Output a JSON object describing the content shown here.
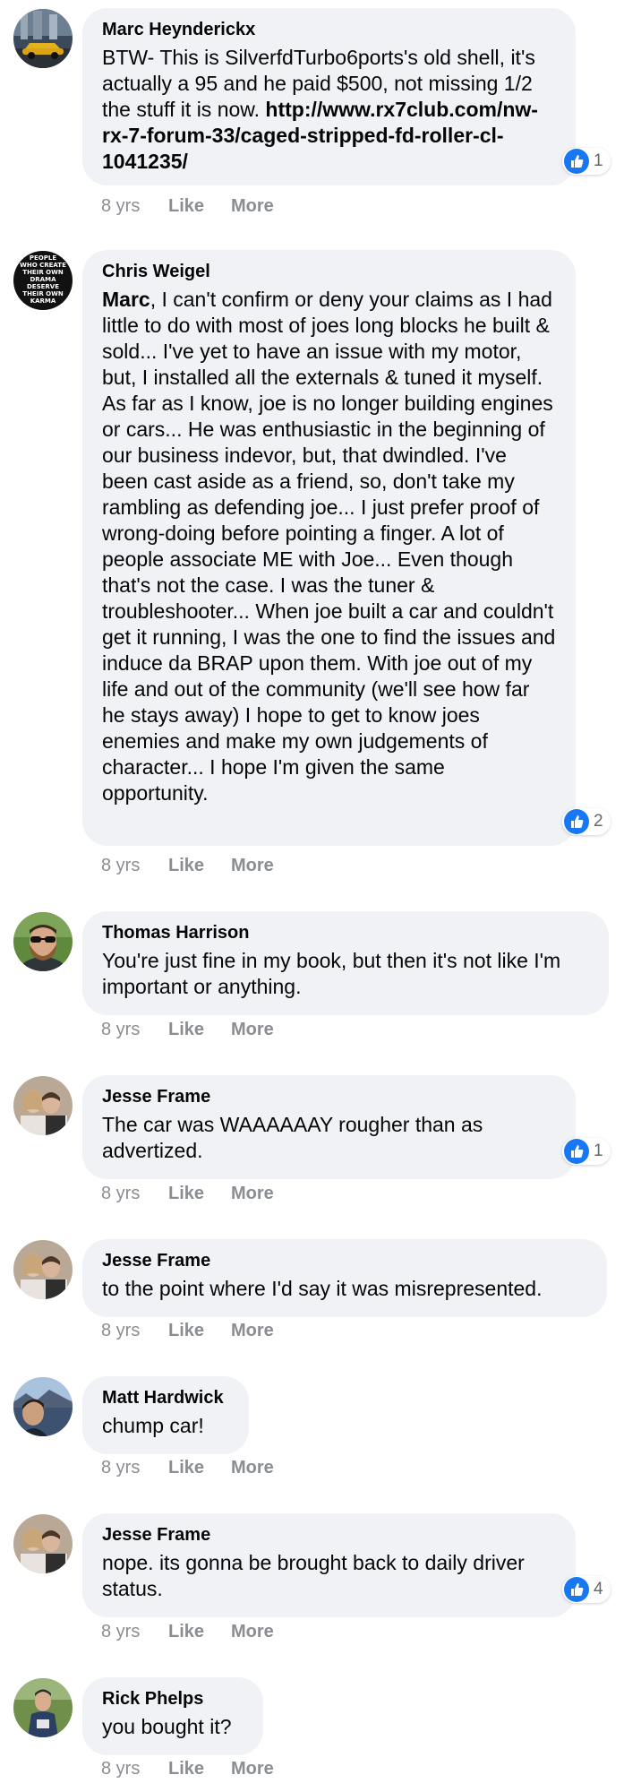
{
  "colors": {
    "bubble": "#f0f2f5",
    "meta": "#8a8d91",
    "like_blue": "#1877f2"
  },
  "comments": [
    {
      "author": "Marc Heynderickx",
      "text_plain": "BTW- This is SilverfdTurbo6ports's old shell, it's actually a 95 and he paid $500, not missing 1/2 the stuff it is now. ",
      "link": "http://www.rx7club.com/nw-rx-7-forum-33/caged-stripped-fd-roller-cl-1041235/",
      "time": "8 yrs",
      "like": "Like",
      "more": "More",
      "reactions": "1"
    },
    {
      "author": "Chris Weigel",
      "mention": "Marc",
      "text_plain": ", I can't confirm or deny your claims as I had little to do with most of joes long blocks he built & sold... I've yet to have an issue with my motor, but, I installed all the externals & tuned it myself. As far as I know, joe is no longer building engines or cars... He was enthusiastic in the beginning of our business indevor, but, that dwindled. I've been cast aside as a friend, so, don't take my rambling as defending joe... I just prefer proof of wrong-doing before pointing a finger. A lot of people associate ME with Joe... Even though that's not the case. I was the tuner & troubleshooter... When joe built a car and couldn't get it running, I was the one to find the issues and induce da BRAP upon them. With joe out of my life and out of the community (we'll see how far he stays away) I hope to get to know joes enemies and make my own judgements of character... I hope I'm given the same opportunity.",
      "time": "8 yrs",
      "like": "Like",
      "more": "More",
      "reactions": "2",
      "avatar_text": [
        "PEOPLE",
        "WHO CREATE",
        "THEIR OWN",
        "DRAMA",
        "DESERVE",
        "THEIR OWN",
        "KARMA"
      ]
    },
    {
      "author": "Thomas Harrison",
      "text_plain": "You're just fine in my book, but then it's not like I'm important or anything.",
      "time": "8 yrs",
      "like": "Like",
      "more": "More"
    },
    {
      "author": "Jesse Frame",
      "text_plain": "The car was WAAAAAAY rougher than as advertized.",
      "time": "8 yrs",
      "like": "Like",
      "more": "More",
      "reactions": "1"
    },
    {
      "author": "Jesse Frame",
      "text_plain": "to the point where I'd say it was misrepresented.",
      "time": "8 yrs",
      "like": "Like",
      "more": "More"
    },
    {
      "author": "Matt Hardwick",
      "text_plain": "chump car!",
      "time": "8 yrs",
      "like": "Like",
      "more": "More"
    },
    {
      "author": "Jesse Frame",
      "text_plain": "nope. its gonna be brought back to daily driver status.",
      "time": "8 yrs",
      "like": "Like",
      "more": "More",
      "reactions": "4"
    },
    {
      "author": "Rick Phelps",
      "text_plain": "you bought it?",
      "time": "8 yrs",
      "like": "Like",
      "more": "More"
    }
  ]
}
